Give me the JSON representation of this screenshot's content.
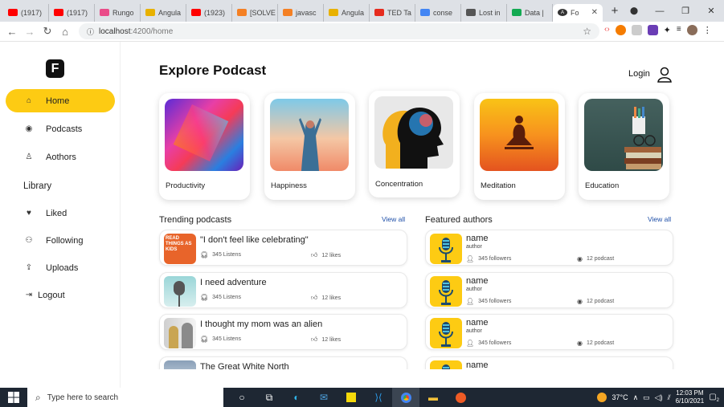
{
  "browser": {
    "tabs": [
      {
        "label": "(1917)",
        "icon": "youtube-icon",
        "color": "#ff0000"
      },
      {
        "label": "(1917)",
        "icon": "youtube-icon",
        "color": "#ff0000"
      },
      {
        "label": "Rungo",
        "icon": "dribbble-icon",
        "color": "#ea4c89"
      },
      {
        "label": "Angula",
        "icon": "tek-icon",
        "color": "#e8b100"
      },
      {
        "label": "(1923)",
        "icon": "youtube-icon",
        "color": "#ff0000"
      },
      {
        "label": "[SOLVE",
        "icon": "stack-icon",
        "color": "#f48024"
      },
      {
        "label": "javasc",
        "icon": "stack-icon",
        "color": "#f48024"
      },
      {
        "label": "Angula",
        "icon": "tek-icon",
        "color": "#e8b100"
      },
      {
        "label": "TED Ta",
        "icon": "ted-icon",
        "color": "#e62b1e"
      },
      {
        "label": "conse",
        "icon": "google-icon",
        "color": "#4285f4"
      },
      {
        "label": "Lost in",
        "icon": "page-icon",
        "color": "#555555"
      },
      {
        "label": "Data |",
        "icon": "mongodb-icon",
        "color": "#13aa52"
      }
    ],
    "active_tab": {
      "label": "Fo",
      "icon": "angular-icon",
      "color": "#333333"
    },
    "url_host": "localhost",
    "url_rest": ":4200/home"
  },
  "sidebar": {
    "logo": "F",
    "nav": [
      {
        "label": "Home",
        "icon": "home-icon",
        "glyph": "⌂",
        "active": true
      },
      {
        "label": "Podcasts",
        "icon": "podcast-icon",
        "glyph": "◉"
      },
      {
        "label": "Aothors",
        "icon": "user-icon",
        "glyph": "♙"
      }
    ],
    "library_heading": "Library",
    "library": [
      {
        "label": "Liked",
        "icon": "heart-icon",
        "glyph": "♥"
      },
      {
        "label": "Following",
        "icon": "user-plus-icon",
        "glyph": "⚇"
      },
      {
        "label": "Uploads",
        "icon": "upload-icon",
        "glyph": "⇪"
      }
    ],
    "logout": {
      "label": "Logout",
      "glyph": "⇥"
    }
  },
  "header": {
    "title": "Explore Podcast",
    "login_label": "Login"
  },
  "categories": [
    {
      "label": "Productivity"
    },
    {
      "label": "Happiness"
    },
    {
      "label": "Concentration"
    },
    {
      "label": "Meditation"
    },
    {
      "label": "Education"
    }
  ],
  "trending": {
    "heading": "Trending podcasts",
    "view_all": "View all",
    "items": [
      {
        "title": "\"I don't feel like celebrating\"",
        "listens": "345 Listens",
        "likes": "12 likes"
      },
      {
        "title": "I need adventure",
        "listens": "345 Listens",
        "likes": "12 likes"
      },
      {
        "title": "I thought my mom was an alien",
        "listens": "345 Listens",
        "likes": "12 likes"
      },
      {
        "title": "The Great White North",
        "listens": "",
        "likes": ""
      }
    ],
    "thumb_text": "READ THINGS AS KIDS"
  },
  "authors": {
    "heading": "Featured authors",
    "view_all": "View all",
    "items": [
      {
        "name": "name",
        "role": "author",
        "followers": "345 followers",
        "podcasts": "12 podcast"
      },
      {
        "name": "name",
        "role": "author",
        "followers": "345 followers",
        "podcasts": "12 podcast"
      },
      {
        "name": "name",
        "role": "author",
        "followers": "345 followers",
        "podcasts": "12 podcast"
      },
      {
        "name": "name",
        "role": "",
        "followers": "",
        "podcasts": ""
      }
    ]
  },
  "taskbar": {
    "search_placeholder": "Type here to search",
    "temperature": "37°C",
    "time": "12:03 PM",
    "date": "6/10/2021",
    "notification_count": "2"
  }
}
